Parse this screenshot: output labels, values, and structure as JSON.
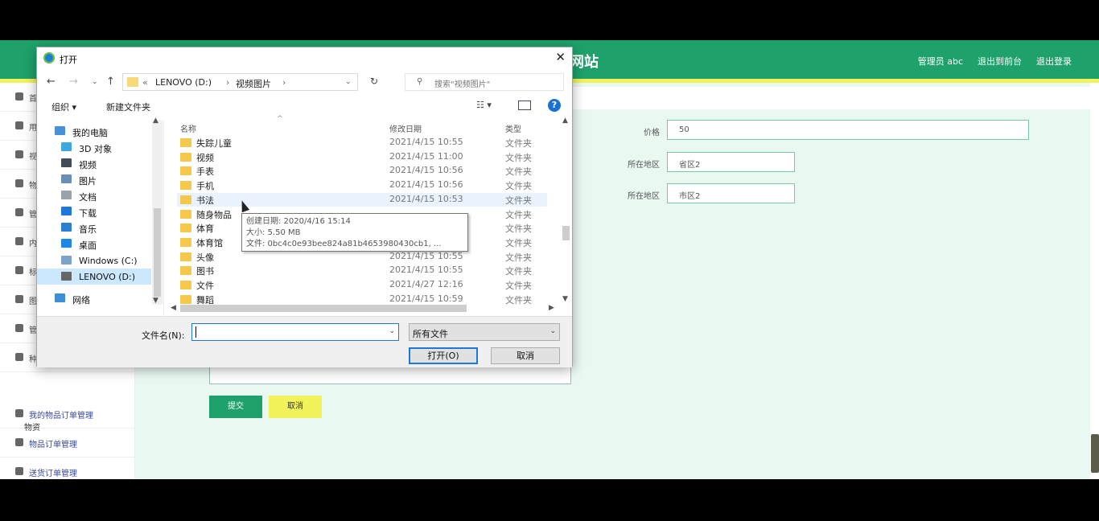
{
  "app": {
    "site_title": "网站",
    "top_links": [
      "管理员 abc",
      "退出到前台",
      "退出登录"
    ]
  },
  "sidebar": {
    "items": [
      {
        "label": "首",
        "icon": "home-icon"
      },
      {
        "label": "用",
        "icon": "user-icon"
      },
      {
        "label": "视",
        "icon": "video-icon"
      },
      {
        "label": "物",
        "icon": "box-icon"
      },
      {
        "label": "管",
        "icon": "list-icon"
      },
      {
        "label": "内",
        "icon": "circle-icon"
      },
      {
        "label": "标",
        "icon": "tag-icon"
      },
      {
        "label": "图",
        "icon": "image-icon"
      },
      {
        "label": "管",
        "icon": "gear-icon"
      },
      {
        "label": "种",
        "icon": "clock-icon"
      },
      {
        "label": "我的物品订单管理",
        "icon": "user-icon"
      },
      {
        "label": "物品订单管理",
        "icon": "gear-icon"
      },
      {
        "label": "送货订单管理",
        "icon": "bird-icon"
      }
    ],
    "sub_label": "物资"
  },
  "form": {
    "price_label": "价格",
    "price_value": "50",
    "region_label": "所在地区",
    "region_value": "省区2",
    "district_label": "所在地区",
    "district_value": "市区2",
    "submit_label": "提交",
    "cancel_label": "取消"
  },
  "dialog": {
    "title": "打开",
    "breadcrumb": [
      "«",
      "LENOVO (D:)",
      "›",
      "视频图片",
      "›"
    ],
    "search_placeholder": "搜索\"视频图片\"",
    "toolbar": {
      "organize": "组织 ▾",
      "new_folder": "新建文件夹",
      "view": "☷ ▾",
      "help": "?"
    },
    "nav": [
      {
        "label": "我的电脑",
        "icon": "computer-icon",
        "color": "#4a90d9"
      },
      {
        "label": "3D 对象",
        "icon": "cube-icon",
        "color": "#3fa7e0"
      },
      {
        "label": "视频",
        "icon": "video-icon",
        "color": "#444c5a"
      },
      {
        "label": "图片",
        "icon": "picture-icon",
        "color": "#6a8fb5"
      },
      {
        "label": "文档",
        "icon": "document-icon",
        "color": "#9aa3ad"
      },
      {
        "label": "下载",
        "icon": "download-icon",
        "color": "#1e78d7"
      },
      {
        "label": "音乐",
        "icon": "music-icon",
        "color": "#2a7fd1"
      },
      {
        "label": "桌面",
        "icon": "desktop-icon",
        "color": "#1e88e5"
      },
      {
        "label": "Windows (C:)",
        "icon": "drive-icon",
        "color": "#7fa3c8"
      },
      {
        "label": "LENOVO (D:)",
        "icon": "drive-icon",
        "color": "#666"
      },
      {
        "label": "网络",
        "icon": "network-icon",
        "color": "#3f8fd6"
      }
    ],
    "columns": {
      "name": "名称",
      "date": "修改日期",
      "type": "类型"
    },
    "files": [
      {
        "name": "失踪儿童",
        "date": "2021/4/15 10:55",
        "type": "文件夹"
      },
      {
        "name": "视频",
        "date": "2021/4/15 11:00",
        "type": "文件夹"
      },
      {
        "name": "手表",
        "date": "2021/4/15 10:56",
        "type": "文件夹"
      },
      {
        "name": "手机",
        "date": "2021/4/15 10:56",
        "type": "文件夹"
      },
      {
        "name": "书法",
        "date": "2021/4/15 10:53",
        "type": "文件夹"
      },
      {
        "name": "随身物品",
        "date": "",
        "type": "文件夹"
      },
      {
        "name": "体育",
        "date": "",
        "type": "文件夹"
      },
      {
        "name": "体育馆",
        "date": "",
        "type": "文件夹"
      },
      {
        "name": "头像",
        "date": "2021/4/15 10:55",
        "type": "文件夹"
      },
      {
        "name": "图书",
        "date": "2021/4/15 10:55",
        "type": "文件夹"
      },
      {
        "name": "文件",
        "date": "2021/4/27 12:16",
        "type": "文件夹"
      },
      {
        "name": "舞蹈",
        "date": "2021/4/15 10:59",
        "type": "文件夹"
      }
    ],
    "tooltip": [
      "创建日期: 2020/4/16 15:14",
      "大小: 5.50 MB",
      "文件: 0bc4c0e93bee824a81b4653980430cb1, ..."
    ],
    "filename_label": "文件名(N):",
    "filename_value": "",
    "filter_value": "所有文件",
    "open_label": "打开(O)",
    "cancel_label": "取消"
  }
}
